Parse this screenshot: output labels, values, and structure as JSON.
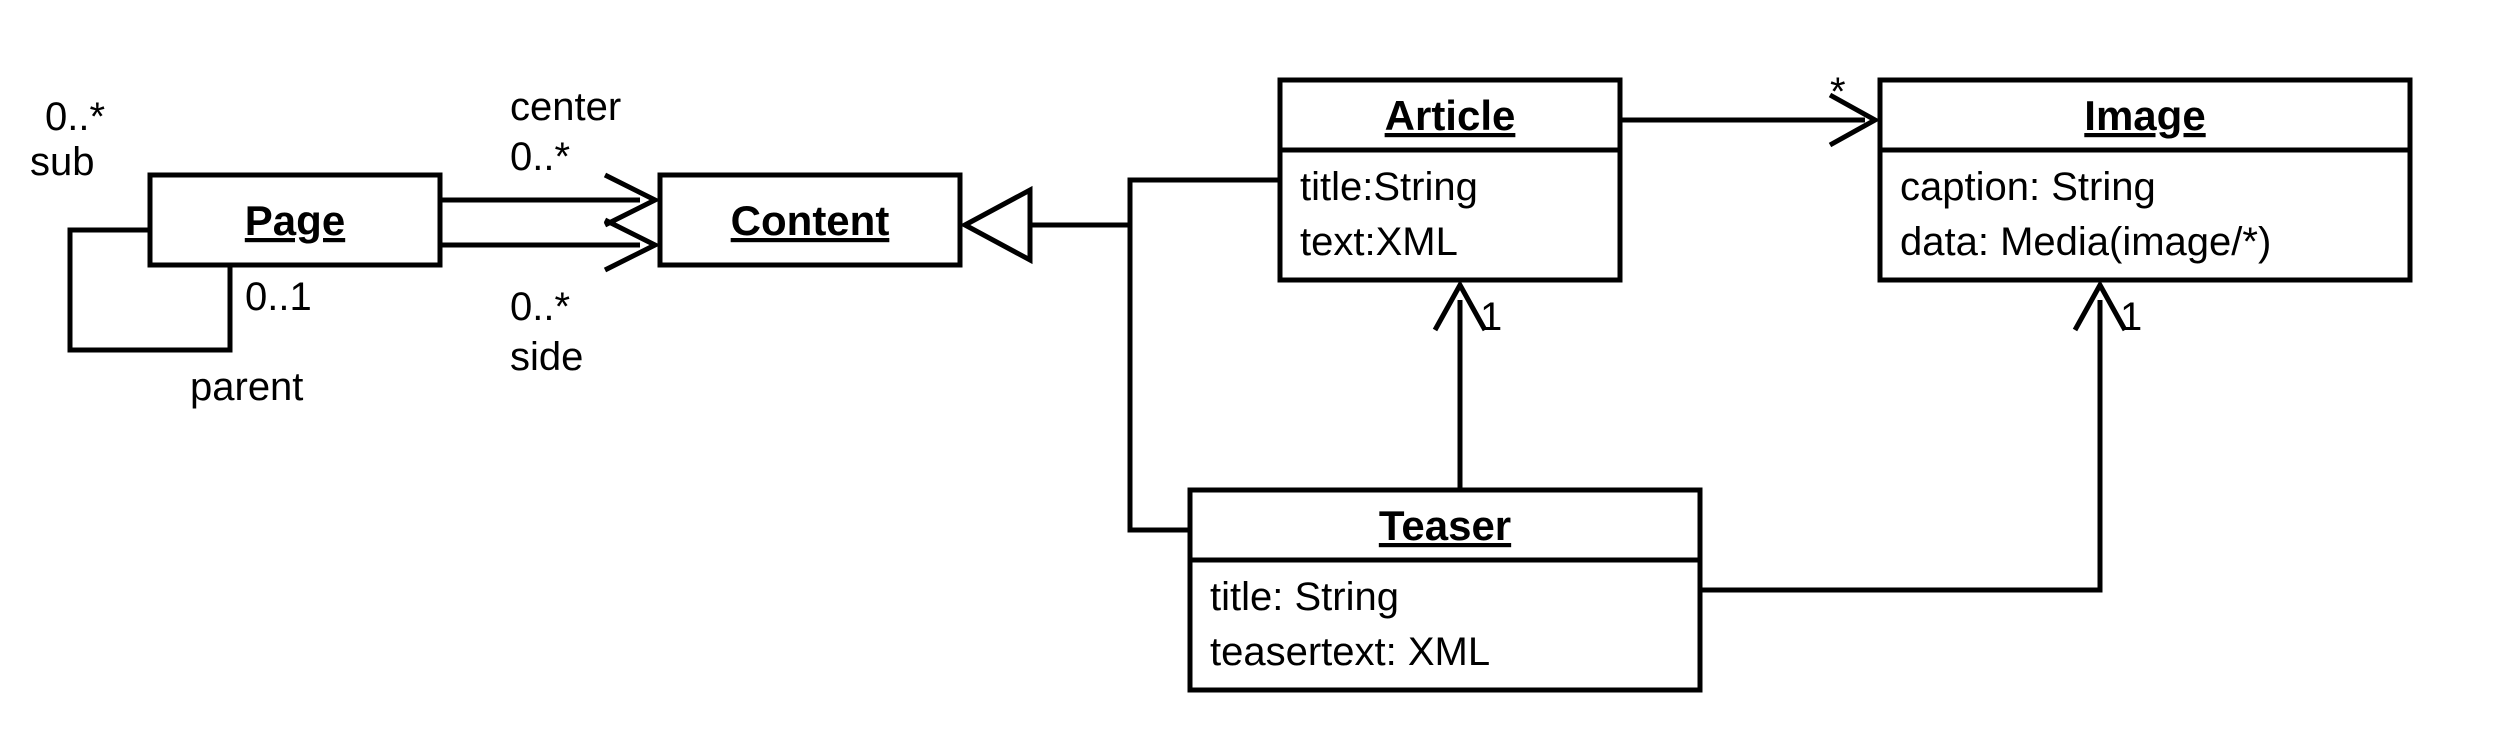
{
  "classes": {
    "page": {
      "name": "Page",
      "attrs": []
    },
    "content": {
      "name": "Content",
      "attrs": []
    },
    "article": {
      "name": "Article",
      "attrs": [
        "title:String",
        "text:XML"
      ]
    },
    "image": {
      "name": "Image",
      "attrs": [
        "caption: String",
        "data: Media(image/*)"
      ]
    },
    "teaser": {
      "name": "Teaser",
      "attrs": [
        "title: String",
        "teasertext: XML"
      ]
    }
  },
  "assoc": {
    "page_self": {
      "sub": {
        "mult": "0..*",
        "role": "sub"
      },
      "parent": {
        "mult": "0..1",
        "role": "parent"
      }
    },
    "page_content_center": {
      "role": "center",
      "mult": "0..*"
    },
    "page_content_side": {
      "role": "side",
      "mult": "0..*"
    },
    "article_image": {
      "mult_image": "*"
    },
    "teaser_article": {
      "mult_article": "1"
    },
    "teaser_image": {
      "mult_image": "1"
    }
  },
  "chart_data": {
    "type": "uml-class",
    "classes": [
      {
        "id": "Page",
        "attributes": []
      },
      {
        "id": "Content",
        "attributes": []
      },
      {
        "id": "Article",
        "attributes": [
          "title:String",
          "text:XML"
        ]
      },
      {
        "id": "Image",
        "attributes": [
          "caption: String",
          "data: Media(image/*)"
        ]
      },
      {
        "id": "Teaser",
        "attributes": [
          "title: String",
          "teasertext: XML"
        ]
      }
    ],
    "generalizations": [
      {
        "child": "Article",
        "parent": "Content"
      },
      {
        "child": "Teaser",
        "parent": "Content"
      }
    ],
    "associations": [
      {
        "from": "Page",
        "to": "Page",
        "end1": {
          "role": "sub",
          "mult": "0..*"
        },
        "end2": {
          "role": "parent",
          "mult": "0..1"
        },
        "navigable": false
      },
      {
        "from": "Page",
        "to": "Content",
        "role": "center",
        "mult": "0..*",
        "navigable": true
      },
      {
        "from": "Page",
        "to": "Content",
        "role": "side",
        "mult": "0..*",
        "navigable": true
      },
      {
        "from": "Article",
        "to": "Image",
        "mult_to": "*",
        "navigable": true
      },
      {
        "from": "Teaser",
        "to": "Article",
        "mult_to": "1",
        "navigable": true
      },
      {
        "from": "Teaser",
        "to": "Image",
        "mult_to": "1",
        "navigable": true
      }
    ]
  }
}
